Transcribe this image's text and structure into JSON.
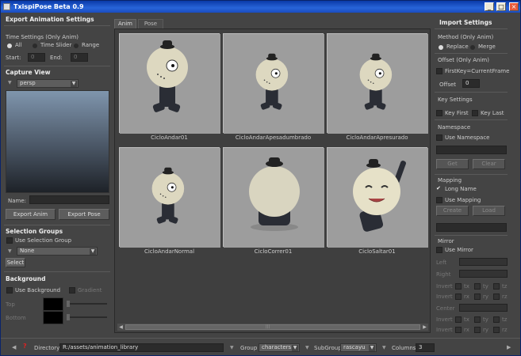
{
  "app": {
    "title": "TxispiPose Beta 0.9"
  },
  "export": {
    "header": "Export Animation Settings",
    "time_label": "Time Settings (Only Anim)",
    "opt_all": "All",
    "opt_slider": "Time Slider",
    "opt_range": "Range",
    "start_label": "Start:",
    "start_val": "0",
    "end_label": "End:",
    "end_val": "0"
  },
  "capture": {
    "header": "Capture View",
    "camera": "persp",
    "name_label": "Name:",
    "name_val": "",
    "export_anim": "Export Anim",
    "export_pose": "Export Pose"
  },
  "selgroups": {
    "header": "Selection Groups",
    "use_label": "Use Selection Group",
    "group_val": "None",
    "select_btn": "Select"
  },
  "background": {
    "header": "Background",
    "use_label": "Use Background",
    "gradient_label": "Gradient",
    "top_label": "Top",
    "bottom_label": "Bottom",
    "top_color": "#000000",
    "bottom_color": "#000000"
  },
  "tabs": [
    {
      "label": "Anim"
    },
    {
      "label": "Pose"
    }
  ],
  "tiles": [
    {
      "label": "CicloAndar01",
      "pose": "side-walk"
    },
    {
      "label": "CicloAndarApesadumbrado",
      "pose": "side-walk-small"
    },
    {
      "label": "CicloAndarApresurado",
      "pose": "side-walk-small"
    },
    {
      "label": "CicloAndarNormal",
      "pose": "side-walk-small"
    },
    {
      "label": "CicloCorrer01",
      "pose": "back"
    },
    {
      "label": "CicloSaltar01",
      "pose": "jump-happy"
    }
  ],
  "import": {
    "header": "Import Settings",
    "method_label": "Method (Only Anim)",
    "opt_replace": "Replace",
    "opt_merge": "Merge",
    "offset_label": "Offset (Only Anim)",
    "firstkey_label": "FirstKey=CurrentFrame",
    "offset_field_label": "Offset",
    "offset_val": "0",
    "keyset_label": "Key Settings",
    "keyfirst": "Key First",
    "keylast": "Key Last",
    "ns_label": "Namespace",
    "use_ns": "Use Namespace",
    "get_btn": "Get",
    "clear_btn": "Clear",
    "mapping_label": "Mapping",
    "longname": "Long Name",
    "use_mapping": "Use Mapping",
    "create_btn": "Create",
    "load_btn": "Load",
    "mirror_label": "Mirror",
    "use_mirror": "Use Mirror",
    "left_label": "Left",
    "right_label": "Right",
    "invert_label": "Invert",
    "center_label": "Center",
    "tx": "tx",
    "ty": "ty",
    "tz": "tz",
    "rx": "rx",
    "ry": "ry",
    "rz": "rz"
  },
  "bottom": {
    "directory_label": "Directory",
    "directory_val": "R:/assets/animation_library",
    "group_label": "Group",
    "group_val": "characters",
    "subgroup_label": "SubGroup",
    "subgroup_val": "rascayu",
    "columns_label": "Columns",
    "columns_val": "3"
  }
}
